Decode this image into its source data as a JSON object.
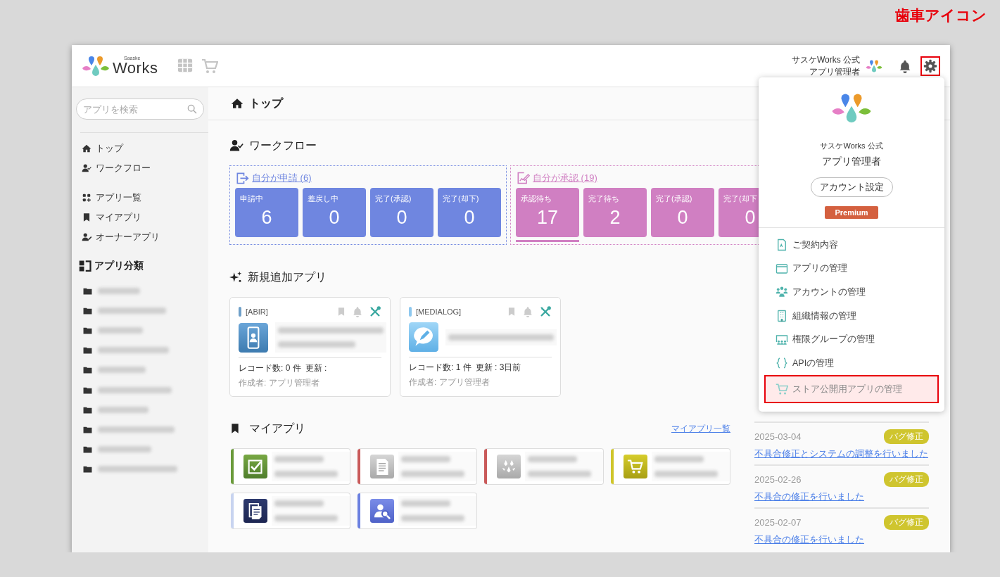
{
  "annotation": {
    "label": "歯車アイコン"
  },
  "header": {
    "logo_small": "Saaske",
    "logo": "Works",
    "user_org": "サスケWorks 公式",
    "user_name": "アプリ管理者",
    "settings_highlighted": true
  },
  "sidebar": {
    "search": {
      "placeholder": "アプリを検索"
    },
    "nav": [
      {
        "label": "トップ",
        "kind": "home"
      },
      {
        "label": "ワークフロー",
        "kind": "workflow"
      },
      {
        "label": "アプリ一覧",
        "kind": "apps"
      },
      {
        "label": "マイアプリ",
        "kind": "bookmark"
      },
      {
        "label": "オーナーアプリ",
        "kind": "owner"
      }
    ],
    "category_title": "アプリ分類",
    "folders": [
      {
        "blurred": true
      },
      {
        "blurred": true
      },
      {
        "blurred": true
      },
      {
        "blurred": true
      },
      {
        "blurred": true
      },
      {
        "blurred": true
      },
      {
        "blurred": true
      },
      {
        "blurred": true
      },
      {
        "blurred": true
      },
      {
        "blurred": true
      }
    ]
  },
  "page_title": "トップ",
  "workflow": {
    "title": "ワークフロー",
    "groups": [
      {
        "kind": "apply",
        "link": "自分が申請 (6)",
        "color": "#6f86e0",
        "cards": [
          {
            "label": "申請中",
            "value": "6",
            "selected": false
          },
          {
            "label": "差戻し中",
            "value": "0",
            "selected": false
          },
          {
            "label": "完了(承認)",
            "value": "0",
            "selected": false
          },
          {
            "label": "完了(却下)",
            "value": "0",
            "selected": false
          }
        ]
      },
      {
        "kind": "approve",
        "link": "自分が承認 (19)",
        "color": "#d07fc2",
        "cards": [
          {
            "label": "承認待ち",
            "value": "17",
            "selected": true
          },
          {
            "label": "完了待ち",
            "value": "2",
            "selected": false
          },
          {
            "label": "完了(承認)",
            "value": "0",
            "selected": false
          },
          {
            "label": "完了(却下",
            "value": "0",
            "selected": false
          }
        ]
      }
    ]
  },
  "new_apps": {
    "title": "新規追加アプリ",
    "apps": [
      {
        "tag": "[ABIR]",
        "color": "#6fa0c9",
        "kind": "phone",
        "blurred": true,
        "records": "レコード数: 0 件",
        "updated": "更新 :",
        "author": "作成者: アプリ管理者"
      },
      {
        "tag": "[MEDIALOG]",
        "color": "#8ec8ef",
        "kind": "bubble",
        "blurred": true,
        "records": "レコード数: 1 件",
        "updated": "更新 : 3日前",
        "author": "作成者: アプリ管理者"
      }
    ]
  },
  "my_apps": {
    "title": "マイアプリ",
    "link": "マイアプリ一覧",
    "apps": [
      {
        "color": "#6a9a3a",
        "kind": "check",
        "blurred": true
      },
      {
        "color": "#c95a5a",
        "kind": "document",
        "blurred": true
      },
      {
        "color": "#c95a5a",
        "kind": "drops",
        "blurred": true
      },
      {
        "color": "#cfc52a",
        "kind": "cart",
        "blurred": true
      },
      {
        "color": "#c8d4f0",
        "kind": "pages",
        "blurred": true
      },
      {
        "color": "#6b80e0",
        "kind": "usersearch",
        "blurred": true
      }
    ]
  },
  "news": {
    "items": [
      {
        "date": "2025-03-04",
        "badge": "バグ修正",
        "text": "不具合修正とシステムの調整を行いました"
      },
      {
        "date": "2025-02-26",
        "badge": "バグ修正",
        "text": "不具合の修正を行いました"
      },
      {
        "date": "2025-02-07",
        "badge": "バグ修正",
        "text": "不具合の修正を行いました"
      }
    ]
  },
  "settings_menu": {
    "org": "サスケWorks 公式",
    "name": "アプリ管理者",
    "account_button": "アカウント設定",
    "plan": "Premium",
    "items": [
      {
        "label": "ご契約内容",
        "kind": "contract",
        "highlighted": false
      },
      {
        "label": "アプリの管理",
        "kind": "window",
        "highlighted": false
      },
      {
        "label": "アカウントの管理",
        "kind": "people",
        "highlighted": false
      },
      {
        "label": "組織情報の管理",
        "kind": "building",
        "highlighted": false
      },
      {
        "label": "権限グループの管理",
        "kind": "group",
        "highlighted": false
      },
      {
        "label": "APIの管理",
        "kind": "braces",
        "highlighted": false
      },
      {
        "label": "ストア公開用アプリの管理",
        "kind": "cart",
        "highlighted": true
      }
    ]
  }
}
